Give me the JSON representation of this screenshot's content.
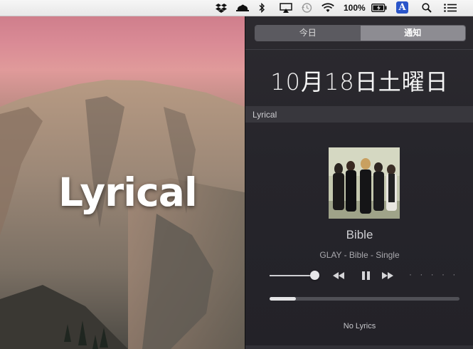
{
  "menubar": {
    "battery_label": "100%",
    "input_method_label": "A",
    "icons": [
      "dropbox-icon",
      "cloud-hat-icon",
      "bluetooth-icon",
      "airplay-icon",
      "time-machine-icon",
      "wifi-icon",
      "battery-icon",
      "input-method-icon",
      "spotlight-icon",
      "notification-center-icon"
    ]
  },
  "wallpaper": {
    "overlay_text": "Lyrical"
  },
  "notification_center": {
    "tabs": [
      {
        "label": "今日"
      },
      {
        "label": "通知"
      }
    ],
    "selected_tab": "通知",
    "date": "10月18日土曜日",
    "widget": {
      "title": "Lyrical",
      "song_title": "Bible",
      "song_subtitle": "GLAY - Bible - Single",
      "volume": 0.95,
      "progress": 0.14,
      "lyrics_status": "No Lyrics"
    }
  },
  "colors": {
    "panel_bg": "#26252b",
    "selected_tab": "#8d8c92",
    "text_light": "#f4f4f4"
  }
}
